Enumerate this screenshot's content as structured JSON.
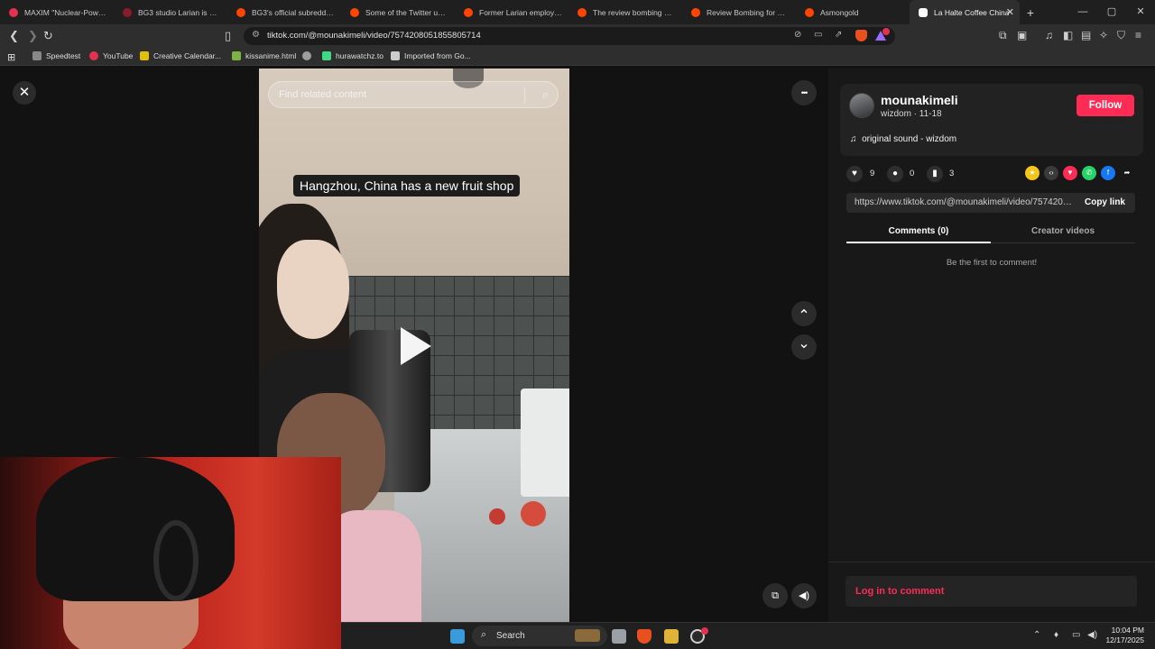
{
  "browser": {
    "tabs": [
      {
        "title": "MAXIM \"Nuclear-Powered",
        "color": "#e3324f"
      },
      {
        "title": "BG3 studio Larian is using",
        "color": "#8a1b2b"
      },
      {
        "title": "BG3's official subreddit cr",
        "color": "#ff4500"
      },
      {
        "title": "Some of the Twitter users",
        "color": "#ff4500"
      },
      {
        "title": "Former Larian employee c",
        "color": "#ff4500"
      },
      {
        "title": "The review bombing of Di",
        "color": "#ff4500"
      },
      {
        "title": "Review Bombing for Divin",
        "color": "#ff4500"
      },
      {
        "title": "Asmongold",
        "color": "#ff4500"
      }
    ],
    "active_tab": {
      "title": "La Halte Coffee China",
      "close": "✕"
    },
    "new_tab": "+",
    "window_controls": {
      "minimize": "—",
      "maximize": "▢",
      "close": "✕"
    },
    "url": "tiktok.com/@mounakimeli/video/7574208051855805714",
    "bookmarks": [
      {
        "label": "Speedtest",
        "color": "#888888"
      },
      {
        "label": "YouTube",
        "color": "#e3324f"
      },
      {
        "label": "Creative Calendar...",
        "color": "#e0c000"
      },
      {
        "label": "kissanime.html",
        "color": "#7cb342"
      },
      {
        "label": "",
        "color": "#9e9e9e"
      },
      {
        "label": "hurawatchz.to",
        "color": "#3ddc84"
      },
      {
        "label": "Imported from Go...",
        "color": "#cccccc"
      }
    ]
  },
  "video": {
    "search_placeholder": "Find related content",
    "caption": "Hangzhou, China has a new fruit shop"
  },
  "panel": {
    "username": "mounakimeli",
    "meta": "wizdom · 11-18",
    "follow_label": "Follow",
    "sound": "original sound - wizdom",
    "likes": "9",
    "comments": "0",
    "saves": "3",
    "share_colors": [
      "#f5c518",
      "#3a3a3a",
      "#fe2c55",
      "#25d366",
      "#1877f2",
      "#181818"
    ],
    "link": "https://www.tiktok.com/@mounakimeli/video/7574208...",
    "copy_label": "Copy link",
    "tab_comments": "Comments (0)",
    "tab_creator": "Creator videos",
    "empty_text": "Be the first to comment!",
    "login_label": "Log in to comment"
  },
  "taskbar": {
    "search_label": "Search",
    "time": "10:04 PM",
    "date": "12/17/2025"
  },
  "icons": {
    "close": "✕",
    "more": "•••",
    "up": "⌃",
    "down": "⌄",
    "search": "⌕",
    "music": "♫",
    "heart": "♥",
    "comment": "●",
    "bookmark": "▮",
    "volume": "🔊"
  }
}
